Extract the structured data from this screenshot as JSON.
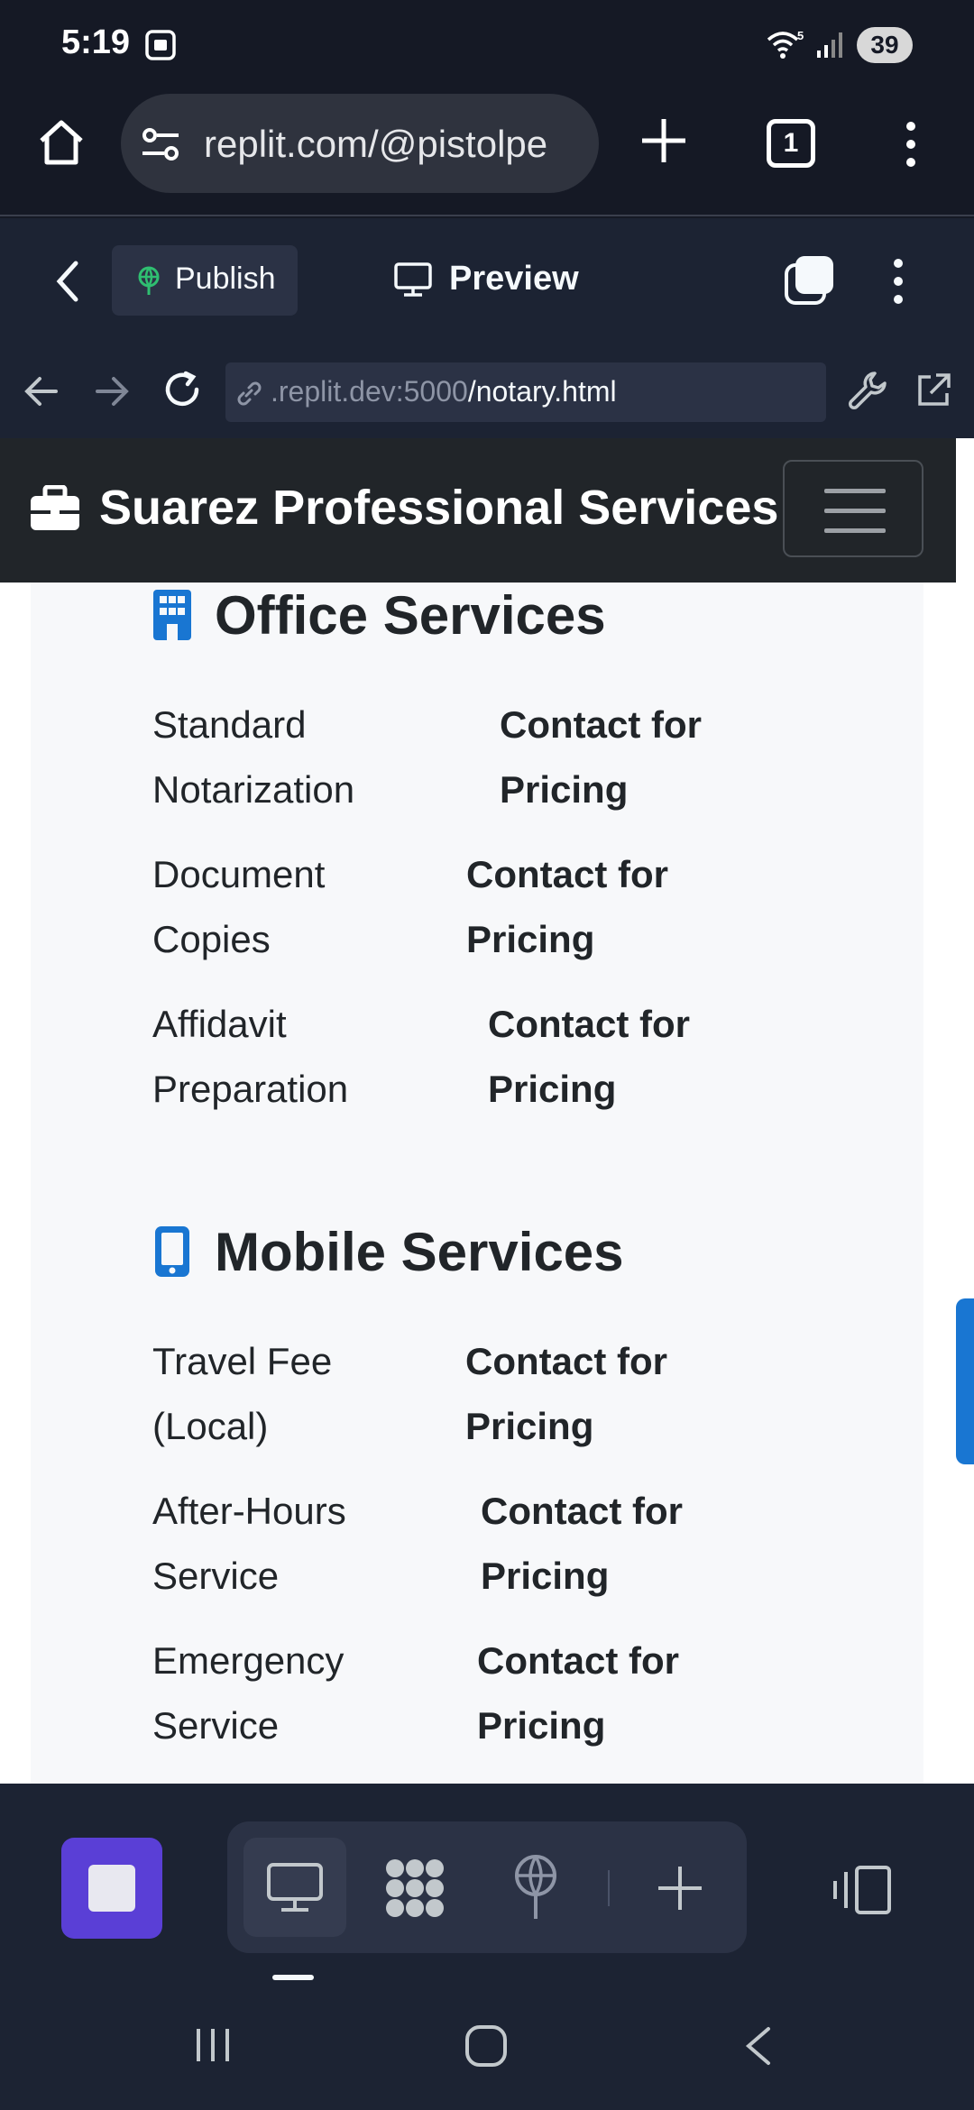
{
  "status_bar": {
    "time": "5:19",
    "wifi_label": "5",
    "battery": "39"
  },
  "chrome": {
    "url": "replit.com/@pistolpe",
    "tab_count": "1"
  },
  "replit_toolbar": {
    "publish_label": "Publish",
    "preview_label": "Preview"
  },
  "webview": {
    "url_host": ".replit.dev:5000",
    "url_path": "/notary.html"
  },
  "site": {
    "brand": "Suarez Professional Services",
    "sections": [
      {
        "title": "Office Services",
        "icon": "building-icon",
        "items": [
          {
            "name": "Standard Notarization",
            "price": "Contact for Pricing"
          },
          {
            "name": "Document Copies",
            "price": "Contact for Pricing"
          },
          {
            "name": "Affidavit Preparation",
            "price": "Contact for Pricing"
          }
        ]
      },
      {
        "title": "Mobile Services",
        "icon": "mobile-phone-icon",
        "items": [
          {
            "name": "Travel Fee (Local)",
            "price": "Contact for Pricing"
          },
          {
            "name": "After-Hours Service",
            "price": "Contact for Pricing"
          },
          {
            "name": "Emergency Service",
            "price": "Contact for Pricing"
          }
        ]
      }
    ]
  },
  "colors": {
    "accent_blue": "#1976d2",
    "replit_purple": "#5a3fd6",
    "navbar_dark": "#212529"
  }
}
